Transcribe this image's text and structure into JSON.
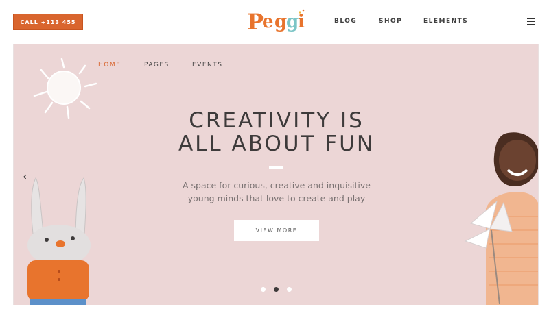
{
  "header": {
    "call_label": "CALL +113 455",
    "logo_letters": [
      "P",
      "e",
      "g",
      "g",
      "i"
    ],
    "nav": [
      {
        "label": "BLOG"
      },
      {
        "label": "SHOP"
      },
      {
        "label": "ELEMENTS"
      }
    ],
    "menu_icon": "hamburger-icon"
  },
  "hero": {
    "nav": [
      {
        "label": "HOME",
        "active": true
      },
      {
        "label": "PAGES",
        "active": false
      },
      {
        "label": "EVENTS",
        "active": false
      }
    ],
    "headline_line1": "CREATIVITY IS",
    "headline_line2": "ALL ABOUT FUN",
    "subtitle_line1": "A space for curious, creative and inquisitive",
    "subtitle_line2": "young minds that love to create and play",
    "button_label": "VIEW MORE",
    "prev_icon": "chevron-left-icon",
    "slides_total": 3,
    "slide_active": 2
  },
  "colors": {
    "accent": "#d9652e",
    "hero_bg": "#ecd6d6",
    "text_dark": "#3e3b3b",
    "logo_orange": "#e8742d",
    "logo_teal": "#7cc5c6",
    "logo_yellow": "#f2b836"
  }
}
